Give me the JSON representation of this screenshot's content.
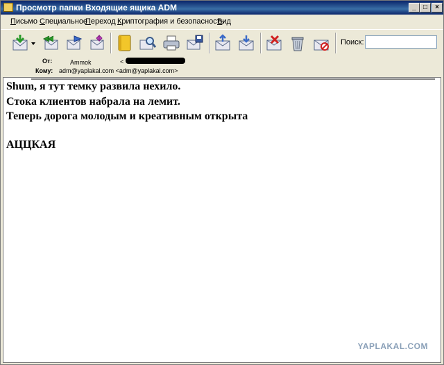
{
  "window": {
    "title": "Просмотр папки Входящие ящика ADM"
  },
  "menu": {
    "items": [
      "Письмо",
      "Специальное",
      "Переход",
      "Криптография и безопасность",
      "Вид"
    ]
  },
  "toolbar": {
    "search_label": "Поиск:",
    "search_value": "",
    "icons": [
      "receive-icon",
      "dropdown-arrow-icon",
      "reply-all-icon",
      "forward-icon",
      "compose-icon",
      "address-book-icon",
      "find-icon",
      "print-icon",
      "save-icon",
      "move-icon",
      "copy-icon",
      "delete-icon",
      "trash-icon",
      "junk-icon"
    ]
  },
  "headers": {
    "from_label": "От:",
    "from_name": "Ammok",
    "from_email": "<",
    "to_label": "Кому:",
    "to_value": "adm@yaplakal.com <adm@yaplakal.com>"
  },
  "message": {
    "lines": [
      "Shum, я тут темку развила нехило.",
      "Стока клиентов набрала на лемит.",
      "Теперь дорога молодым и креативным открыта",
      "",
      "АЦЦКАЯ"
    ]
  },
  "watermark": "YAPLAKAL.COM"
}
